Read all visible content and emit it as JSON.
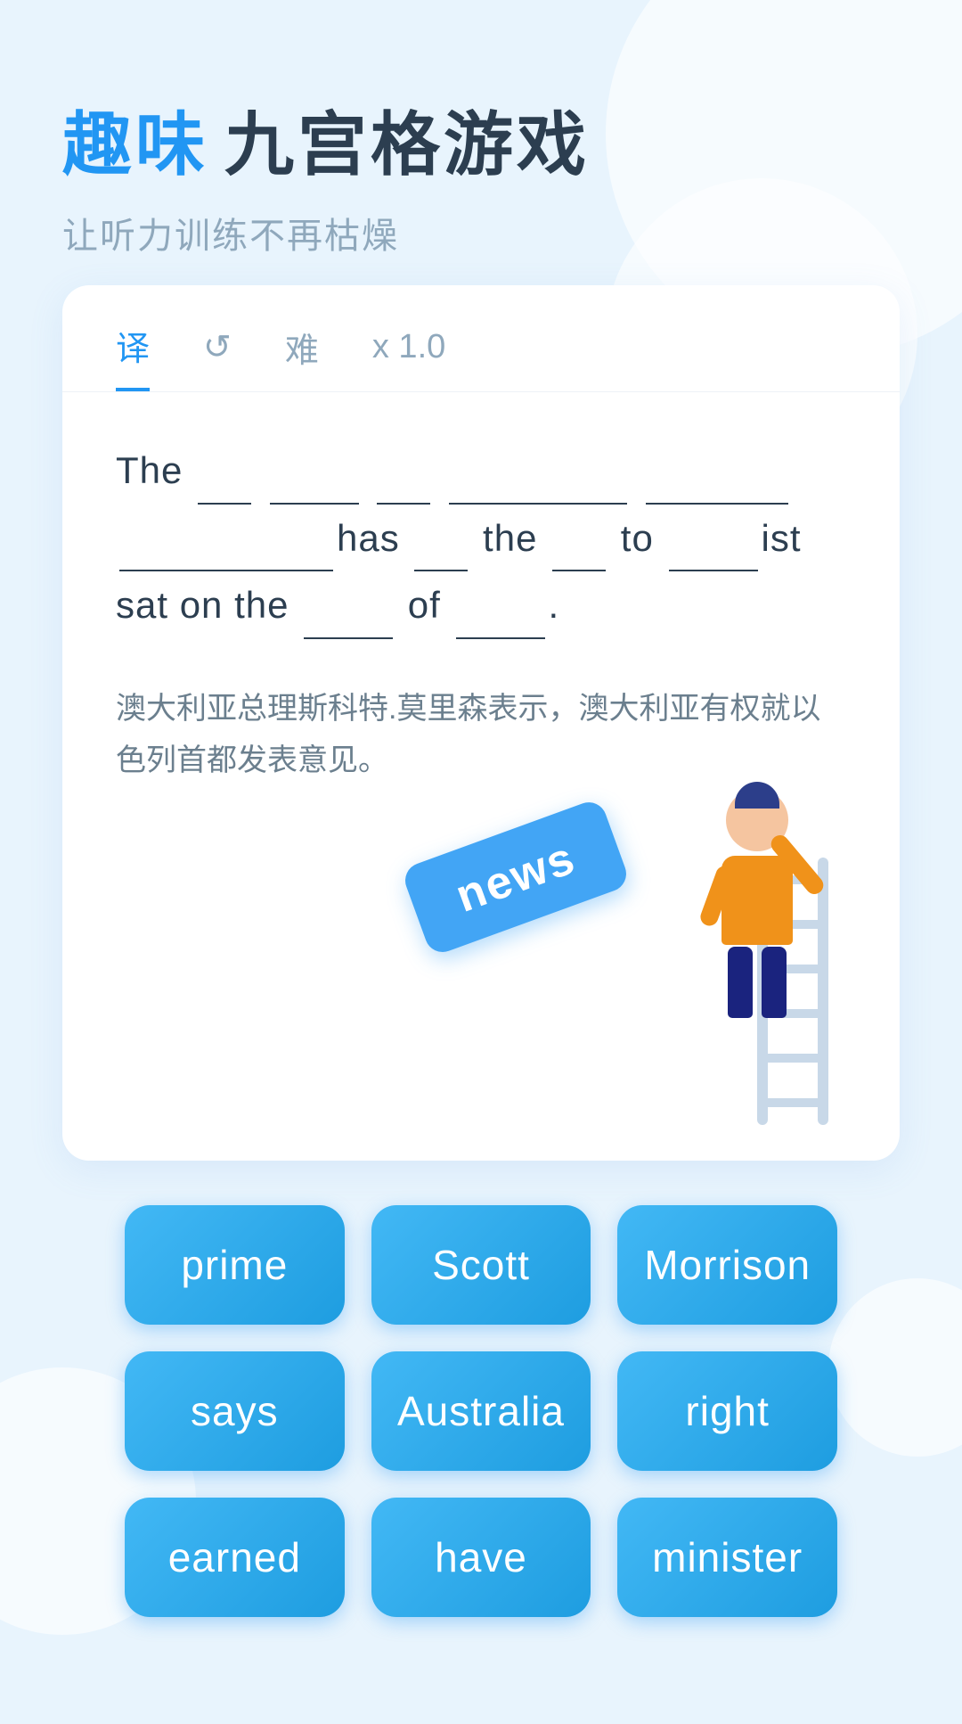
{
  "header": {
    "title_blue": "趣味",
    "title_dark": "九宫格游戏",
    "subtitle": "让听力训练不再枯燥"
  },
  "tabs": [
    {
      "label": "译",
      "active": true
    },
    {
      "label": "↺",
      "active": false
    },
    {
      "label": "难",
      "active": false
    },
    {
      "label": "x 1.0",
      "active": false
    }
  ],
  "sentence": {
    "text": "The ___ ______ ___ __________ _____ ________has ___ the ___ to _____ist sat on the ____ of ___.",
    "parts": [
      "The",
      "___",
      "______",
      "___",
      "__________",
      "_____",
      "________",
      "has",
      "___",
      "the",
      "___",
      "to",
      "_____",
      "ist",
      "sat",
      "on",
      "the",
      "____",
      "of",
      "____."
    ]
  },
  "translation": "澳大利亚总理斯科特.莫里森表示，澳大利亚有权就以色列首都发表意见。",
  "news_badge": "news",
  "words": [
    {
      "label": "prime"
    },
    {
      "label": "Scott"
    },
    {
      "label": "Morrison"
    },
    {
      "label": "says"
    },
    {
      "label": "Australia"
    },
    {
      "label": "right"
    },
    {
      "label": "earned"
    },
    {
      "label": "have"
    },
    {
      "label": "minister"
    }
  ]
}
